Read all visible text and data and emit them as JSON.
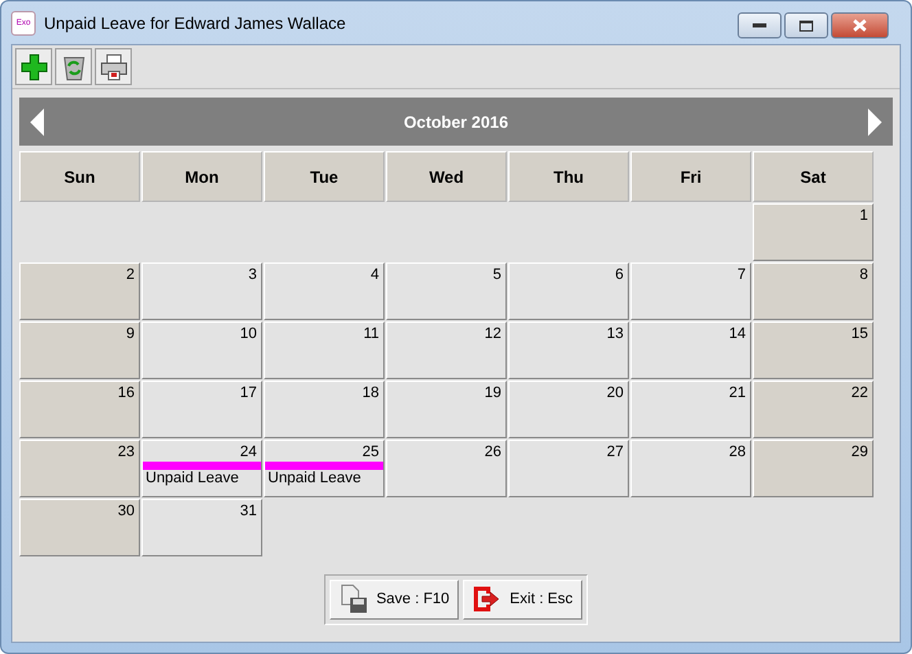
{
  "window": {
    "title": "Unpaid Leave for Edward James Wallace",
    "app_icon": "Exo"
  },
  "toolbar": [
    {
      "kind": "add"
    },
    {
      "kind": "refresh"
    },
    {
      "kind": "print"
    }
  ],
  "calendar": {
    "month": "October 2016",
    "weekdays": [
      "Sun",
      "Mon",
      "Tue",
      "Wed",
      "Thu",
      "Fri",
      "Sat"
    ],
    "weeks": [
      [
        {
          "kind": "blank"
        },
        {
          "kind": "blank"
        },
        {
          "kind": "blank"
        },
        {
          "kind": "blank"
        },
        {
          "kind": "blank"
        },
        {
          "kind": "blank"
        },
        {
          "kind": "day",
          "day": "1",
          "weekend": true
        }
      ],
      [
        {
          "kind": "day",
          "day": "2",
          "weekend": true
        },
        {
          "kind": "day",
          "day": "3",
          "weekend": false
        },
        {
          "kind": "day",
          "day": "4",
          "weekend": false
        },
        {
          "kind": "day",
          "day": "5",
          "weekend": false
        },
        {
          "kind": "day",
          "day": "6",
          "weekend": false
        },
        {
          "kind": "day",
          "day": "7",
          "weekend": false
        },
        {
          "kind": "day",
          "day": "8",
          "weekend": true
        }
      ],
      [
        {
          "kind": "day",
          "day": "9",
          "weekend": true
        },
        {
          "kind": "day",
          "day": "10",
          "weekend": false
        },
        {
          "kind": "day",
          "day": "11",
          "weekend": false
        },
        {
          "kind": "day",
          "day": "12",
          "weekend": false
        },
        {
          "kind": "day",
          "day": "13",
          "weekend": false
        },
        {
          "kind": "day",
          "day": "14",
          "weekend": false
        },
        {
          "kind": "day",
          "day": "15",
          "weekend": true
        }
      ],
      [
        {
          "kind": "day",
          "day": "16",
          "weekend": true
        },
        {
          "kind": "day",
          "day": "17",
          "weekend": false
        },
        {
          "kind": "day",
          "day": "18",
          "weekend": false
        },
        {
          "kind": "day",
          "day": "19",
          "weekend": false
        },
        {
          "kind": "day",
          "day": "20",
          "weekend": false
        },
        {
          "kind": "day",
          "day": "21",
          "weekend": false
        },
        {
          "kind": "day",
          "day": "22",
          "weekend": true
        }
      ],
      [
        {
          "kind": "day",
          "day": "23",
          "weekend": true
        },
        {
          "kind": "day",
          "day": "24",
          "weekend": false,
          "events": [
            {
              "label": "Unpaid Leave",
              "color": "#ff00ff"
            }
          ]
        },
        {
          "kind": "day",
          "day": "25",
          "weekend": false,
          "events": [
            {
              "label": "Unpaid Leave",
              "color": "#ff00ff"
            }
          ]
        },
        {
          "kind": "day",
          "day": "26",
          "weekend": false
        },
        {
          "kind": "day",
          "day": "27",
          "weekend": false
        },
        {
          "kind": "day",
          "day": "28",
          "weekend": false
        },
        {
          "kind": "day",
          "day": "29",
          "weekend": true
        }
      ],
      [
        {
          "kind": "day",
          "day": "30",
          "weekend": true
        },
        {
          "kind": "day",
          "day": "31",
          "weekend": false
        },
        {
          "kind": "blank"
        },
        {
          "kind": "blank"
        },
        {
          "kind": "blank"
        },
        {
          "kind": "blank"
        },
        {
          "kind": "blank"
        }
      ]
    ]
  },
  "buttons": [
    {
      "kind": "save",
      "label": "Save : F10"
    },
    {
      "kind": "exit",
      "label": "Exit : Esc"
    }
  ]
}
